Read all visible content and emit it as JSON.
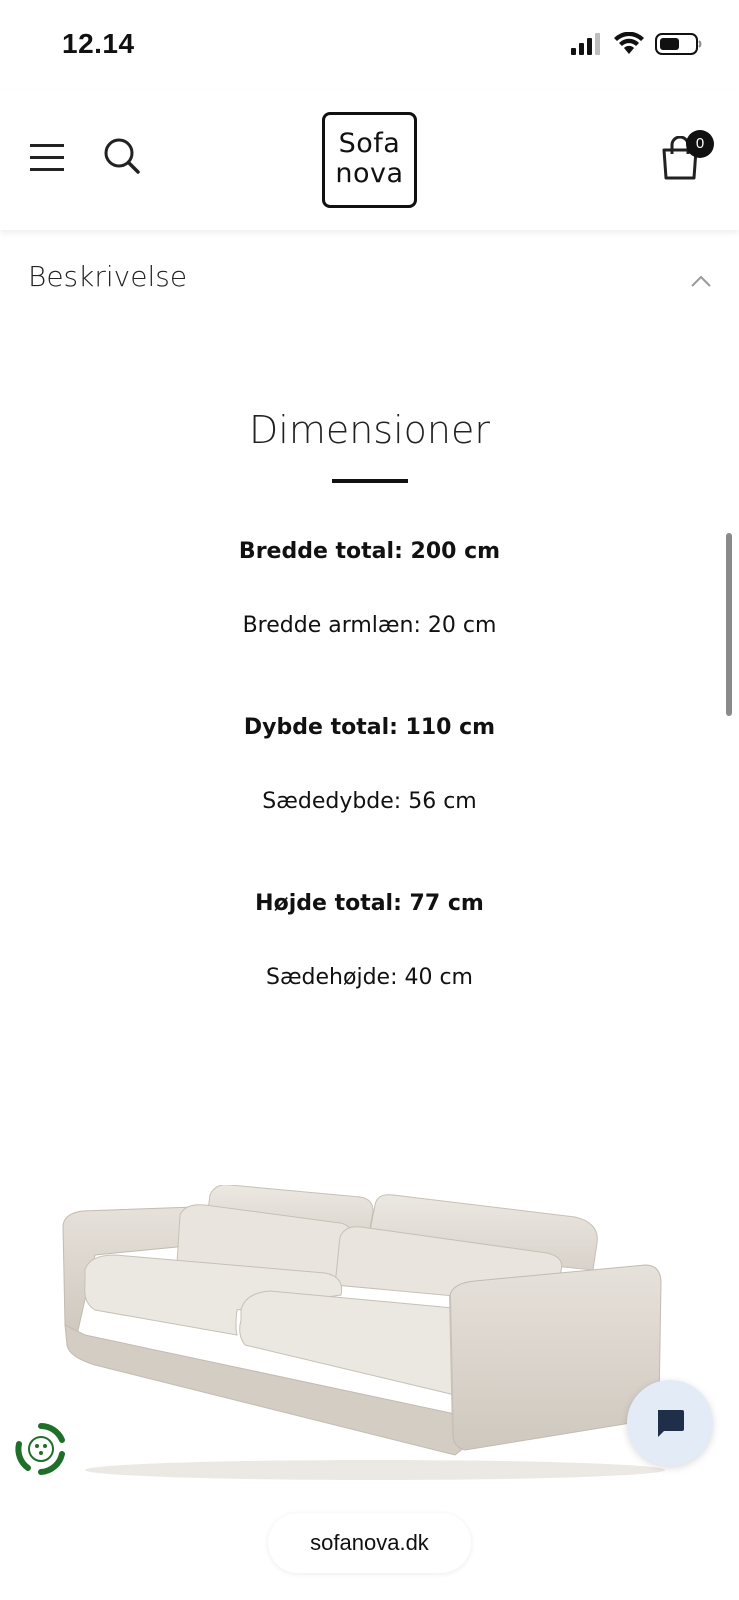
{
  "status_bar": {
    "time": "12.14"
  },
  "header": {
    "logo_line1": "Sofa",
    "logo_line2": "nova",
    "cart_count": "0",
    "icons": [
      "hamburger-menu-icon",
      "search-icon",
      "shopping-bag-icon"
    ]
  },
  "accordion": {
    "title": "Beskrivelse",
    "expanded": true,
    "toggle_icon": "chevron-up-icon"
  },
  "dimensions": {
    "heading": "Dimensioner",
    "lines": [
      {
        "text": "Bredde total: 200 cm",
        "bold": true
      },
      {
        "text": "Bredde armlæn: 20 cm",
        "bold": false
      },
      {
        "text": "Dybde total: 110 cm",
        "bold": true
      },
      {
        "text": "Sædedybde: 56 cm",
        "bold": false
      },
      {
        "text": "Højde total: 77 cm",
        "bold": true
      },
      {
        "text": "Sædehøjde: 40 cm",
        "bold": false
      }
    ]
  },
  "product_image": {
    "icon": "sofa-image"
  },
  "widgets": {
    "eco_icon": "eco-badge-icon",
    "chat_icon": "chat-bubble-icon"
  },
  "browser": {
    "url": "sofanova.dk"
  },
  "colors": {
    "primary": "#111111",
    "chat_bg": "#e3ebf6",
    "chat_icon": "#1f2f4a",
    "eco_green": "#1f6e2a"
  }
}
